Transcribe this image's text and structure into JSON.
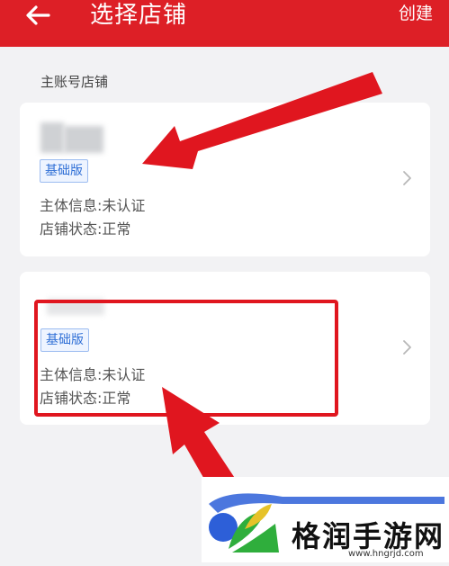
{
  "header": {
    "title": "选择店铺",
    "create_label": "创建",
    "back_icon": "arrow-left-icon",
    "background_color": "#dd1f26"
  },
  "section": {
    "label": "主账号店铺"
  },
  "stores": [
    {
      "badge": "基础版",
      "subject_info": "主体信息:未认证",
      "store_status": "店铺状态:正常"
    },
    {
      "badge": "基础版",
      "subject_info": "主体信息:未认证",
      "store_status": "店铺状态:正常"
    }
  ],
  "watermark": {
    "name": "格润手游网",
    "url": "www.hngrjd.com"
  },
  "colors": {
    "accent_red": "#e0161f",
    "badge_blue": "#2f6fd6"
  }
}
